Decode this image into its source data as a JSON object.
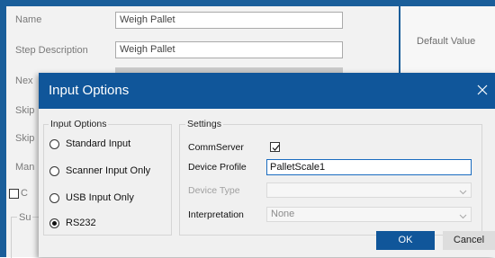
{
  "form": {
    "fields": [
      {
        "label": "Name",
        "value": "Weigh Pallet"
      },
      {
        "label": "Step Description",
        "value": "Weigh Pallet"
      },
      {
        "label": "Nex"
      },
      {
        "label": "Skip"
      },
      {
        "label": "Skip"
      },
      {
        "label": "Man"
      }
    ],
    "checkbox_label": "C",
    "fieldset_label": "Su",
    "right_header": "Default Value"
  },
  "dialog": {
    "title": "Input Options",
    "input_options": {
      "legend": "Input Options",
      "options": [
        {
          "label": "Standard Input",
          "selected": false
        },
        {
          "label": "Scanner Input Only",
          "selected": false
        },
        {
          "label": "USB Input Only",
          "selected": false
        },
        {
          "label": "RS232",
          "selected": true
        }
      ]
    },
    "settings": {
      "legend": "Settings",
      "commserver_label": "CommServer",
      "commserver_checked": true,
      "device_profile_label": "Device Profile",
      "device_profile_value": "PalletScale1",
      "device_type_label": "Device Type",
      "device_type_value": "",
      "interpretation_label": "Interpretation",
      "interpretation_value": "None"
    },
    "ok_label": "OK",
    "cancel_label": "Cancel"
  },
  "colors": {
    "accent": "#10569a",
    "dialog_bg": "#f0f0f0"
  }
}
